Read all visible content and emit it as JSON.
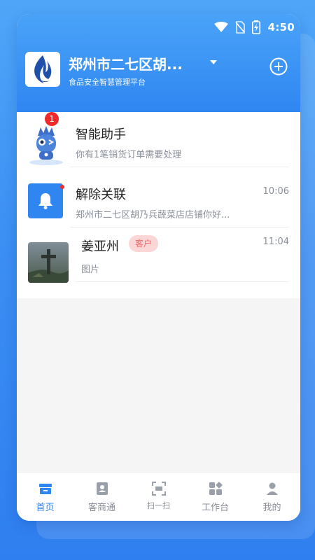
{
  "status_bar": {
    "time": "4:50",
    "icons": [
      "wifi-icon",
      "no-sim-icon",
      "battery-charging-icon"
    ]
  },
  "header": {
    "store_name": "郑州市二七区胡...",
    "subtitle": "食品安全智慧管理平台",
    "dropdown_icon": "caret-down-icon",
    "add_icon": "plus-circle-icon"
  },
  "conversations": [
    {
      "title": "智能助手",
      "preview": "你有1笔销货订单需要处理",
      "time": "",
      "badge": "1",
      "icon": "assistant-mascot-icon"
    },
    {
      "title": "解除关联",
      "preview": "郑州市二七区胡乃兵蔬菜店店铺你好...",
      "time": "10:06",
      "icon": "bell-icon",
      "unread_dot": true
    },
    {
      "title": "姜亚州",
      "tag": "客户",
      "preview": "图片",
      "time": "11:04",
      "icon": "avatar-photo"
    }
  ],
  "tabbar": {
    "items": [
      {
        "label": "首页",
        "icon": "home-store-icon",
        "active": true
      },
      {
        "label": "客商通",
        "icon": "contacts-icon",
        "active": false
      },
      {
        "label": "扫一扫",
        "icon": "scan-icon",
        "active": false
      },
      {
        "label": "工作台",
        "icon": "workbench-icon",
        "active": false
      },
      {
        "label": "我的",
        "icon": "profile-icon",
        "active": false
      }
    ]
  },
  "colors": {
    "primary": "#2f86f1",
    "badge_red": "#f02a2a",
    "tag_bg": "#fbd6d6",
    "tag_text": "#f26b6b"
  }
}
